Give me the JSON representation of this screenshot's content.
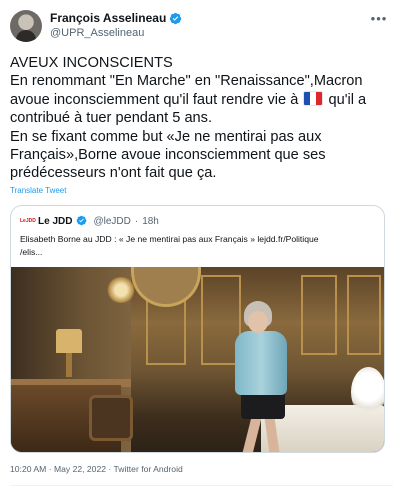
{
  "author": {
    "display_name": "François Asselineau",
    "handle": "@UPR_Asselineau",
    "verified_icon": "verified-badge-icon"
  },
  "tweet": {
    "lines": [
      "AVEUX INCONSCIENTS",
      "En renommant \"En Marche\" en \"Renaissance\",Macron",
      "avoue inconsciemment qu'il faut rendre vie à",
      "qu'il a",
      "contribué à tuer pendant 5 ans.",
      "En se fixant comme but «Je ne mentirai pas aux",
      "Français»,Borne avoue inconsciemment que ses",
      "prédécesseurs n'ont fait que ça."
    ],
    "flag_icon": "france-flag-icon",
    "translate_label": "Translate Tweet",
    "timestamp": "10:20 AM · May 22, 2022 · Twitter for Android"
  },
  "quoted": {
    "name": "Le JDD",
    "handle": "@leJDD",
    "separator": "·",
    "time": "18h",
    "text_line1": "Elisabeth Borne au JDD : « Je ne mentirai pas aux Français » lejdd.fr/Politique",
    "text_line2": "/elis..."
  },
  "colors": {
    "link": "#1d9bf0",
    "secondary_text": "#536471",
    "verified": "#1d9bf0"
  }
}
